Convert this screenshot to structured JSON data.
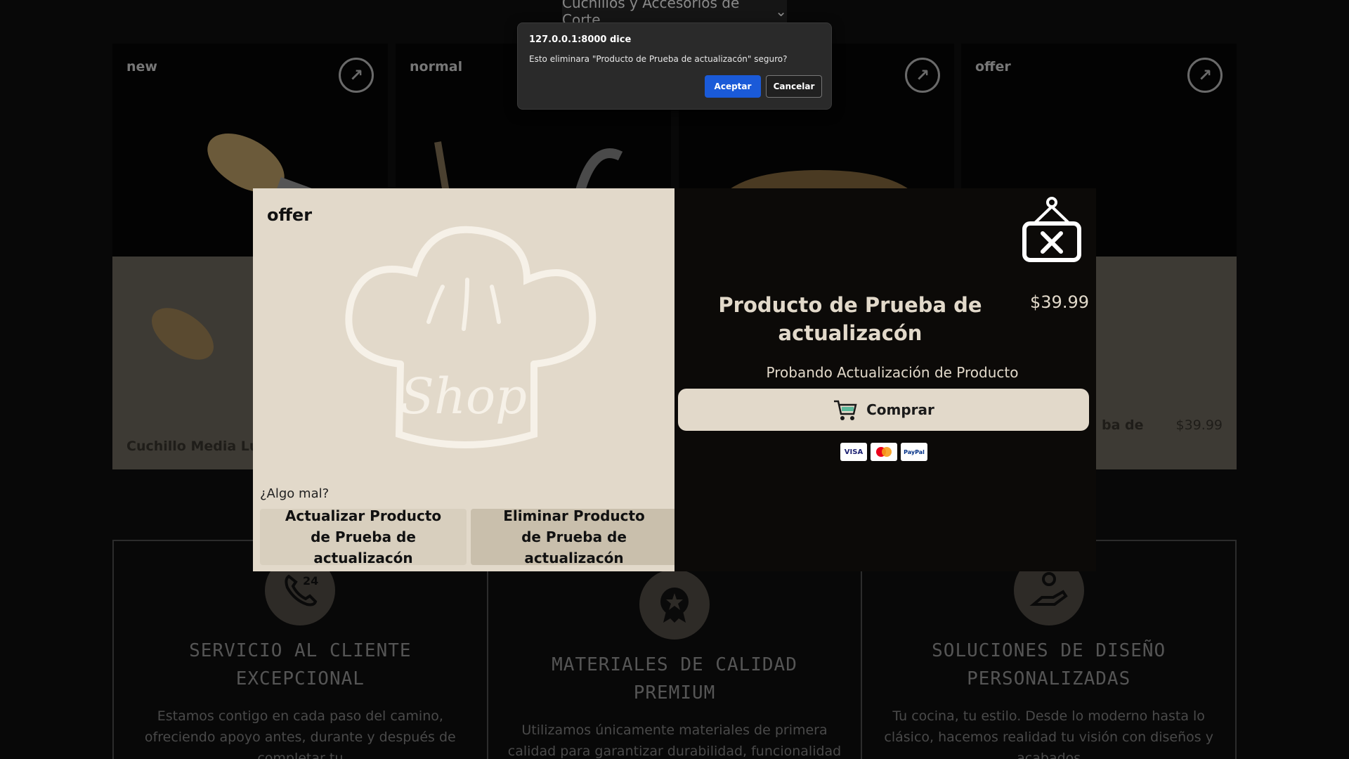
{
  "category_select": {
    "label": "Cuchillos y Accesorios de Corte"
  },
  "cards": [
    {
      "tag": "new",
      "name": "Cuchillo Media Lun",
      "price": ""
    },
    {
      "tag": "normal",
      "name": "",
      "price": ""
    },
    {
      "tag": "",
      "name": "",
      "price": ""
    },
    {
      "tag": "offer",
      "name": "ba de",
      "price": "$39.99"
    }
  ],
  "features": [
    {
      "icon": "phone-24-icon",
      "title": "SERVICIO AL CLIENTE EXCEPCIONAL",
      "text": "Estamos contigo en cada paso del camino, ofreciendo apoyo antes, durante y después de completar tu"
    },
    {
      "icon": "award-star-icon",
      "title": "MATERIALES DE CALIDAD PREMIUM",
      "text": "Utilizamos únicamente materiales de primera calidad para garantizar durabilidad, funcionalidad y belleza que duren toda la vida."
    },
    {
      "icon": "idea-hand-icon",
      "title": "SOLUCIONES DE DISEÑO PERSONALIZADAS",
      "text": "Tu cocina, tu estilo. Desde lo moderno hasta lo clásico, hacemos realidad tu visión con diseños y acabados"
    }
  ],
  "modal": {
    "tag": "offer",
    "image_text": "Shop",
    "something_wrong": "¿Algo mal?",
    "update_button": "Actualizar Producto de Prueba de actualizacón",
    "delete_button": "Eliminar Producto de Prueba de actualizacón",
    "product_title": "Producto de Prueba de actualizacón",
    "price": "$39.99",
    "description": "Probando Actualización de Producto",
    "buy_button": "Comprar",
    "payment_methods": [
      "VISA",
      "MC",
      "PayPal"
    ]
  },
  "dialog": {
    "origin": "127.0.0.1:8000 dice",
    "message": "Esto eliminara \"Producto de Prueba de actualizacón\" seguro?",
    "ok": "Aceptar",
    "cancel": "Cancelar"
  },
  "colors": {
    "cream": "#e2d9ca",
    "accent_blue": "#1a5ad8",
    "background": "#080808"
  }
}
